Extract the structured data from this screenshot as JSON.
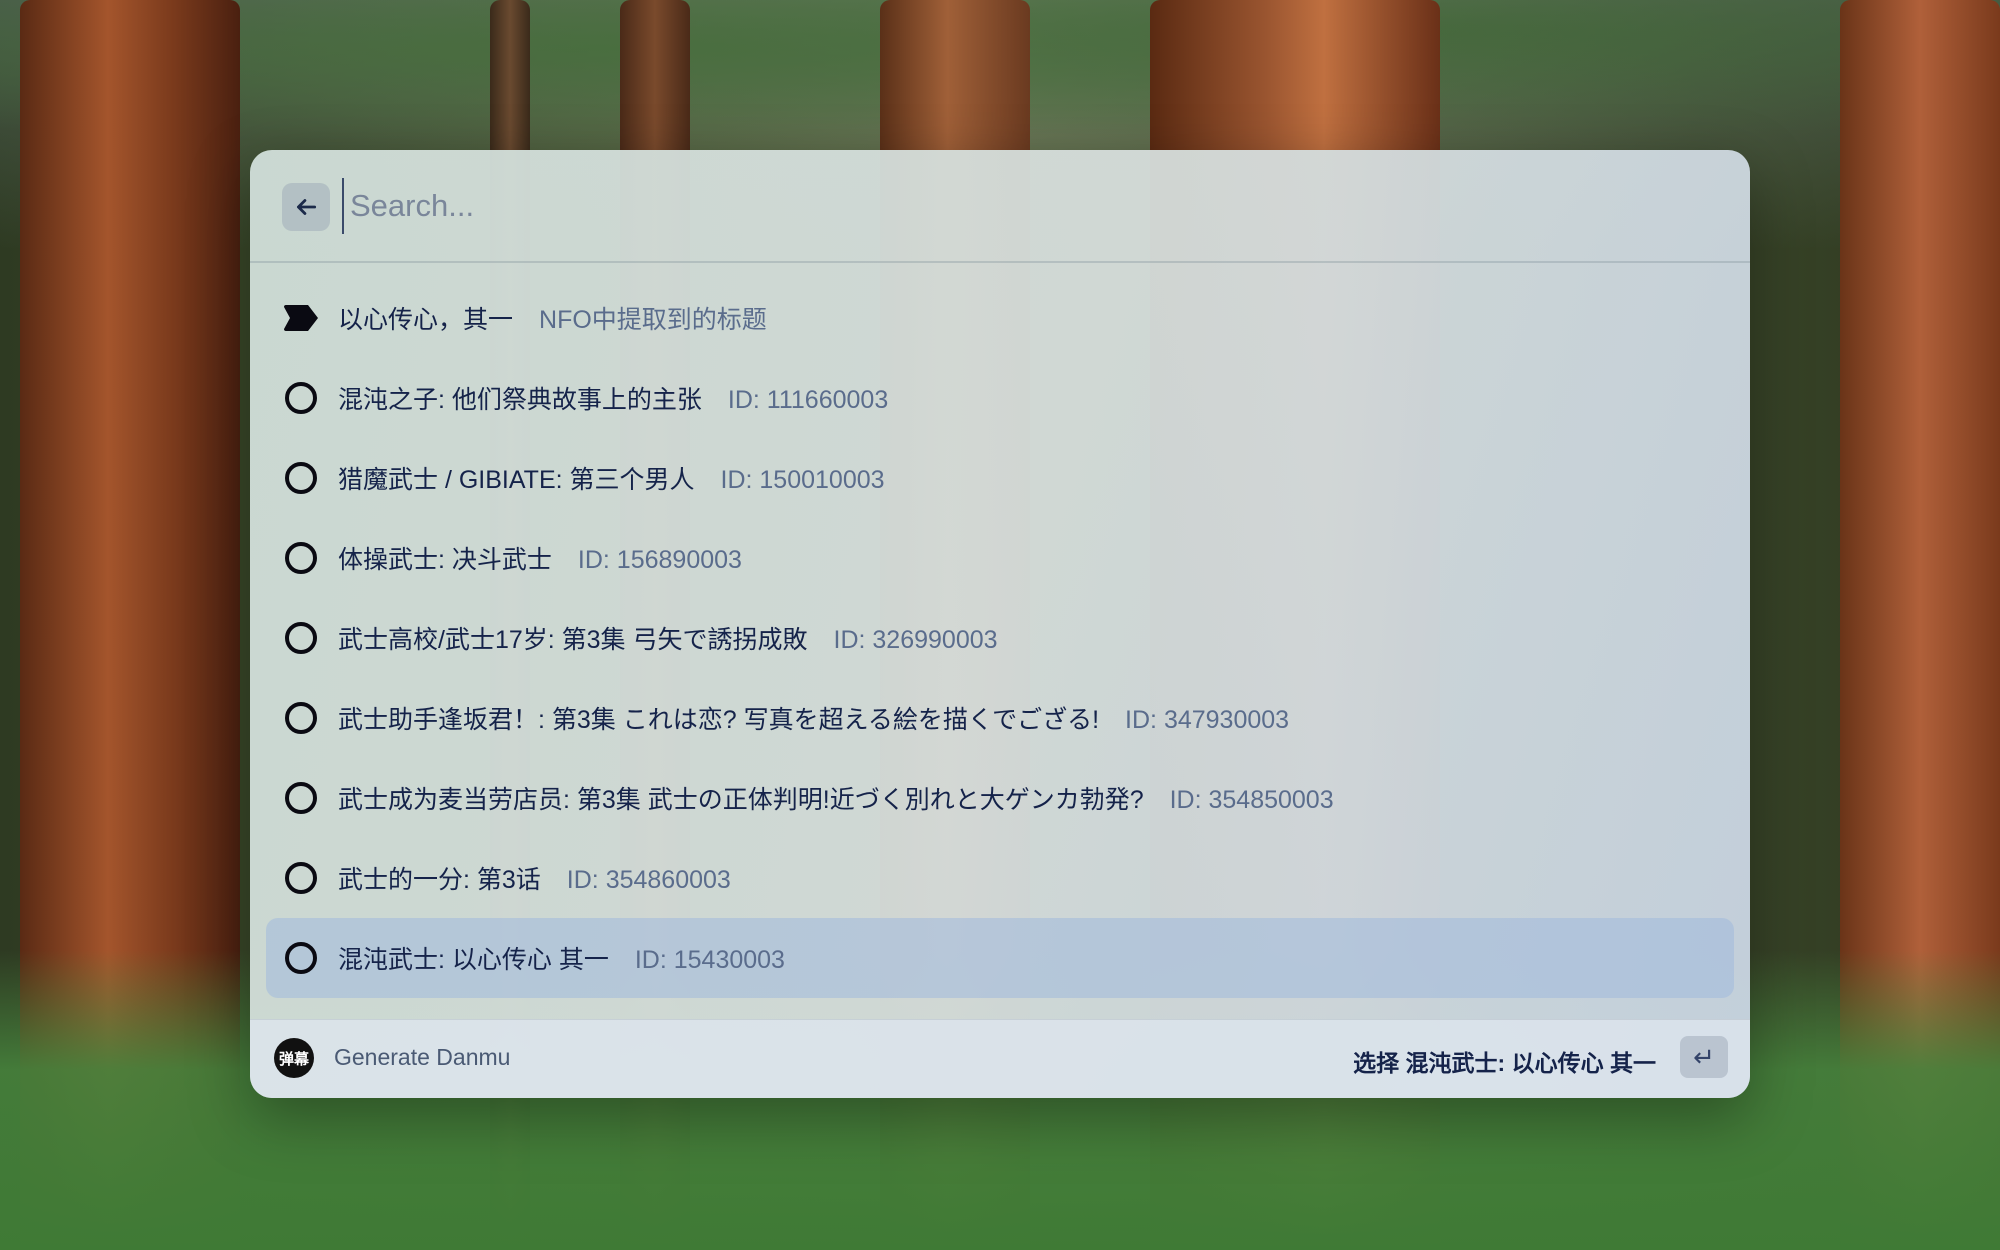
{
  "search": {
    "placeholder": "Search...",
    "value": ""
  },
  "items": [
    {
      "title": "以心传心，其一",
      "subtitle": "NFO中提取到的标题",
      "icon": "tag-icon",
      "selected": false
    },
    {
      "title": "混沌之子: 他们祭典故事上的主张",
      "subtitle": "ID: 111660003",
      "icon": "circle-icon",
      "selected": false
    },
    {
      "title": "猎魔武士 / GIBIATE: 第三个男人",
      "subtitle": "ID: 150010003",
      "icon": "circle-icon",
      "selected": false
    },
    {
      "title": "体操武士: 决斗武士",
      "subtitle": "ID: 156890003",
      "icon": "circle-icon",
      "selected": false
    },
    {
      "title": "武士高校/武士17岁: 第3集 弓矢で誘拐成敗",
      "subtitle": "ID: 326990003",
      "icon": "circle-icon",
      "selected": false
    },
    {
      "title": "武士助手逢坂君！: 第3集 これは恋? 写真を超える絵を描くでござる!",
      "subtitle": "ID: 347930003",
      "icon": "circle-icon",
      "selected": false
    },
    {
      "title": "武士成为麦当劳店员: 第3集 武士の正体判明!近づく別れと大ゲンカ勃発?",
      "subtitle": "ID: 354850003",
      "icon": "circle-icon",
      "selected": false
    },
    {
      "title": "武士的一分: 第3话",
      "subtitle": "ID: 354860003",
      "icon": "circle-icon",
      "selected": false
    },
    {
      "title": "混沌武士: 以心传心 其一",
      "subtitle": "ID: 15430003",
      "icon": "circle-icon",
      "selected": true
    }
  ],
  "footer": {
    "app_logo_text": "弹幕",
    "app_name": "Generate Danmu",
    "action_label": "选择 混沌武士: 以心传心 其一",
    "enter_key": "↵"
  }
}
